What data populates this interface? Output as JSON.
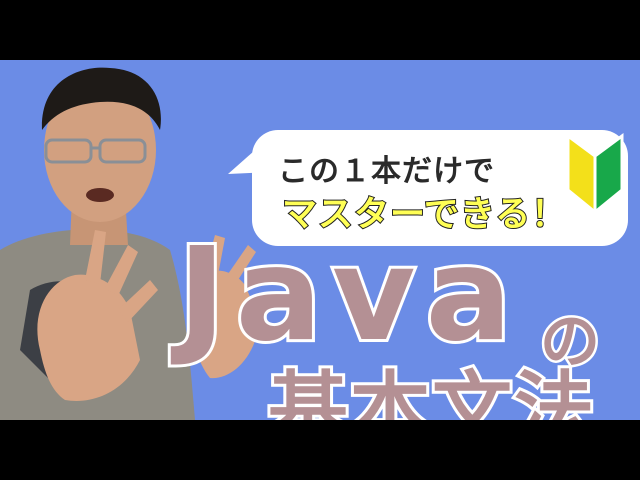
{
  "bubble": {
    "line1": "この１本だけで",
    "line2": "マスターできる！"
  },
  "title": {
    "java": "Java",
    "no": "の",
    "subject": "基本文法"
  },
  "colors": {
    "background": "#6b8ce6",
    "title_fill": "#b49094",
    "title_outline": "#ffffff",
    "highlight_text": "#ffff55"
  },
  "icons": [
    "beginner-mark-icon"
  ]
}
